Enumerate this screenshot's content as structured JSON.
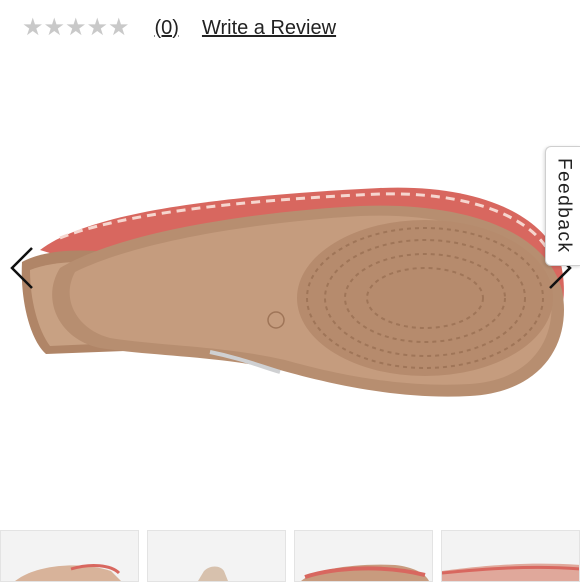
{
  "rating": {
    "stars": [
      "★",
      "★",
      "★",
      "★",
      "★"
    ],
    "star_value": 0,
    "count_label": "(0)",
    "write_review_label": "Write a Review"
  },
  "gallery": {
    "main_image_icon": "shoe-sole-image",
    "prev_icon": "chevron-left-icon",
    "next_icon": "chevron-right-icon",
    "thumbnails": [
      "thumbnail-1",
      "thumbnail-2",
      "thumbnail-3",
      "thumbnail-4"
    ]
  },
  "feedback": {
    "label": "Feedback"
  },
  "colors": {
    "star_empty": "#c9c9c9",
    "sole": "#b9957a",
    "upper": "#d8675f",
    "text": "#222222"
  }
}
